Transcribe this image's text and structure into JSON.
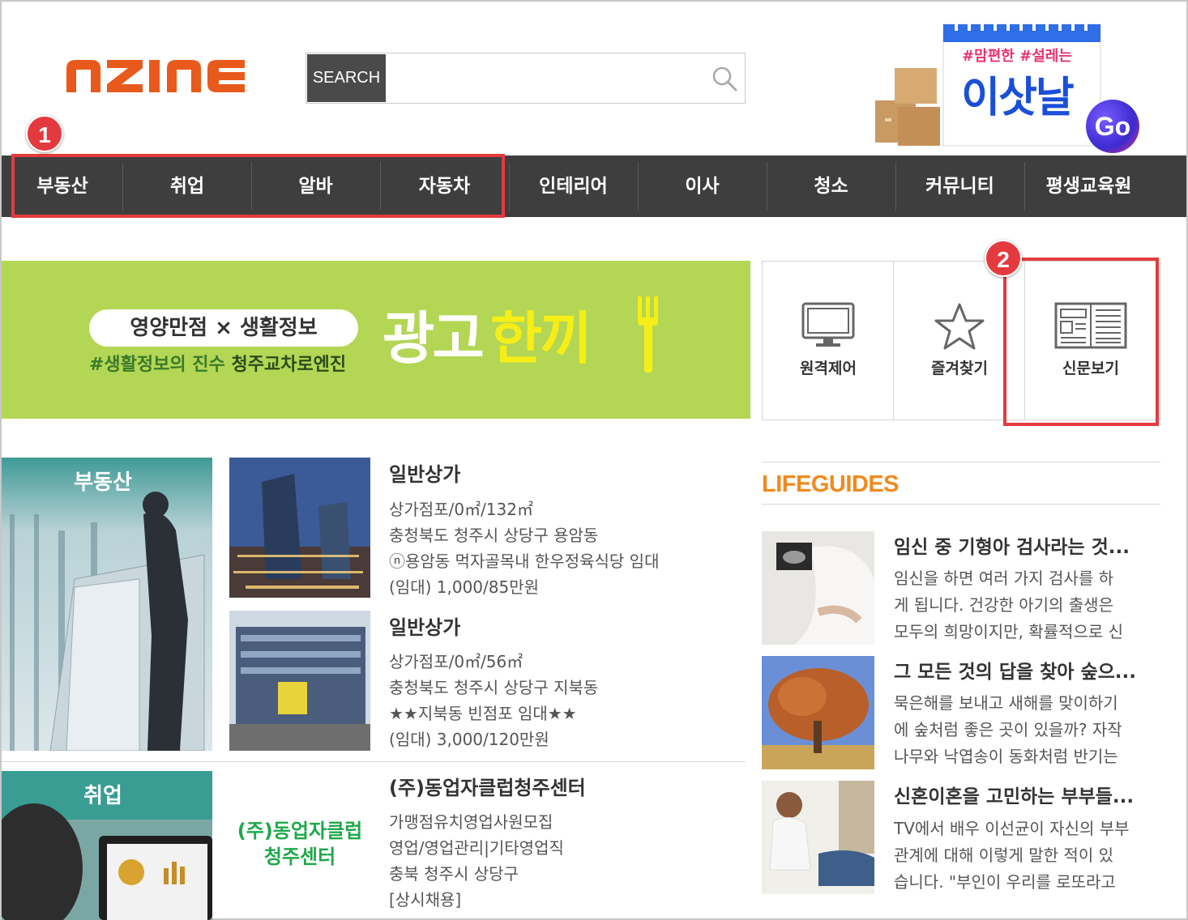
{
  "header": {
    "logo_text": "nzine",
    "search": {
      "label": "SEARCH",
      "placeholder": ""
    },
    "banner": {
      "tag": "#맘편한 #설레는",
      "title": "이삿날",
      "go": "Go"
    }
  },
  "nav": {
    "items": [
      "부동산",
      "취업",
      "알바",
      "자동차",
      "인테리어",
      "이사",
      "청소",
      "커뮤니티",
      "평생교육원"
    ]
  },
  "annotations": {
    "badge1": "1",
    "badge2": "2"
  },
  "ad": {
    "pill": "영양만점 × 생활정보",
    "sub_green": "#생활정보의 진수",
    "sub_dark": "청주교차로엔진",
    "big_white": "광고",
    "big_yellow": "한끼"
  },
  "quick": {
    "items": [
      {
        "label": "원격제어",
        "icon": "monitor-icon"
      },
      {
        "label": "즐겨찾기",
        "icon": "star-icon"
      },
      {
        "label": "신문보기",
        "icon": "newspaper-icon"
      }
    ]
  },
  "listings": {
    "realestate": {
      "category": "부동산",
      "items": [
        {
          "title": "일반상가",
          "lines": [
            "상가점포/0㎡/132㎡",
            "충청북도 청주시 상당구 용암동",
            "ⓝ용암동 먹자골목내 한우정육식당 임대",
            "(임대) 1,000/85만원"
          ]
        },
        {
          "title": "일반상가",
          "lines": [
            "상가점포/0㎡/56㎡",
            "충청북도 청주시 상당구 지북동",
            "★★지북동 빈점포 임대★★",
            "(임대) 3,000/120만원"
          ]
        }
      ]
    },
    "jobs": {
      "category": "취업",
      "logo_text_1": "(주)동업자클럽",
      "logo_text_2": "청주센터",
      "items": [
        {
          "title": "(주)동업자클럽청주센터",
          "lines": [
            "가맹점유치영업사원모집",
            "영업/영업관리|기타영업직",
            "충북 청주시 상당구",
            "[상시채용]"
          ]
        }
      ]
    }
  },
  "lifeguides": {
    "heading": "LIFEGUIDES",
    "items": [
      {
        "title": "임신 중 기형아 검사라는 것...",
        "lines": [
          "임신을 하면 여러 가지 검사를 하",
          "게 됩니다. 건강한 아기의 출생은",
          "모두의 희망이지만, 확률적으로 신"
        ]
      },
      {
        "title": "그 모든 것의 답을 찾아 숲으...",
        "lines": [
          "묵은해를 보내고 새해를 맞이하기",
          "에 숲처럼 좋은 곳이 있을까? 자작",
          "나무와 낙엽송이 동화처럼 반기는"
        ]
      },
      {
        "title": "신혼이혼을 고민하는 부부들...",
        "lines": [
          "TV에서 배우 이선균이 자신의 부부",
          "관계에 대해 이렇게 말한 적이 있",
          "습니다. \"부인이 우리를 로또라고"
        ]
      }
    ]
  },
  "colors": {
    "accent": "#e85a1c",
    "nav_bg": "#3e3e3e",
    "highlight": "#e43a3f",
    "lifeguides": "#f08a1e",
    "ad_bg": "#b3d655"
  }
}
